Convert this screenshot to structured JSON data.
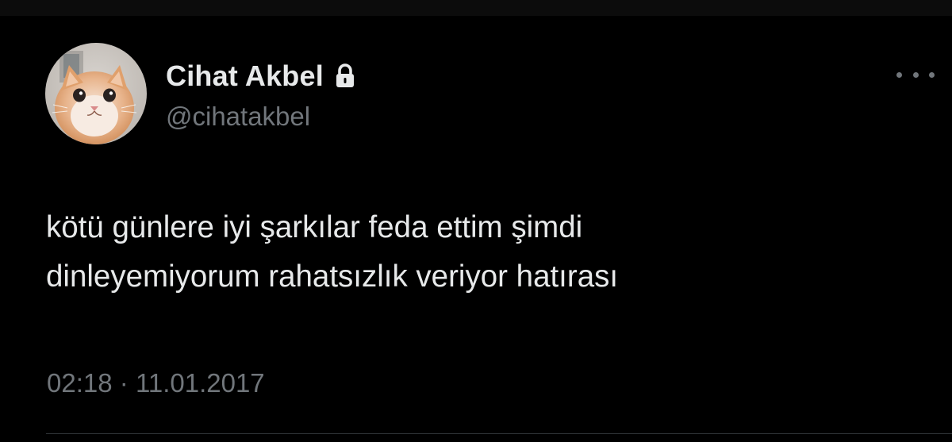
{
  "author": {
    "display_name": "Cihat Akbel",
    "handle": "@cihatakbel",
    "protected": true,
    "verified_icon": "lock-icon",
    "avatar_description": "cat-photo-avatar"
  },
  "tweet": {
    "text_lines": [
      "kötü günlere iyi şarkılar feda ettim şimdi",
      "dinleyemiyorum rahatsızlık veriyor hatırası"
    ],
    "time": "02:18",
    "separator": "·",
    "date": "11.01.2017"
  },
  "icons": {
    "more": "more-horizontal-icon",
    "lock": "lock-icon"
  },
  "colors": {
    "background": "#000000",
    "primary_text": "#e7e9ea",
    "secondary_text": "#71767b",
    "divider": "#2f3336"
  }
}
